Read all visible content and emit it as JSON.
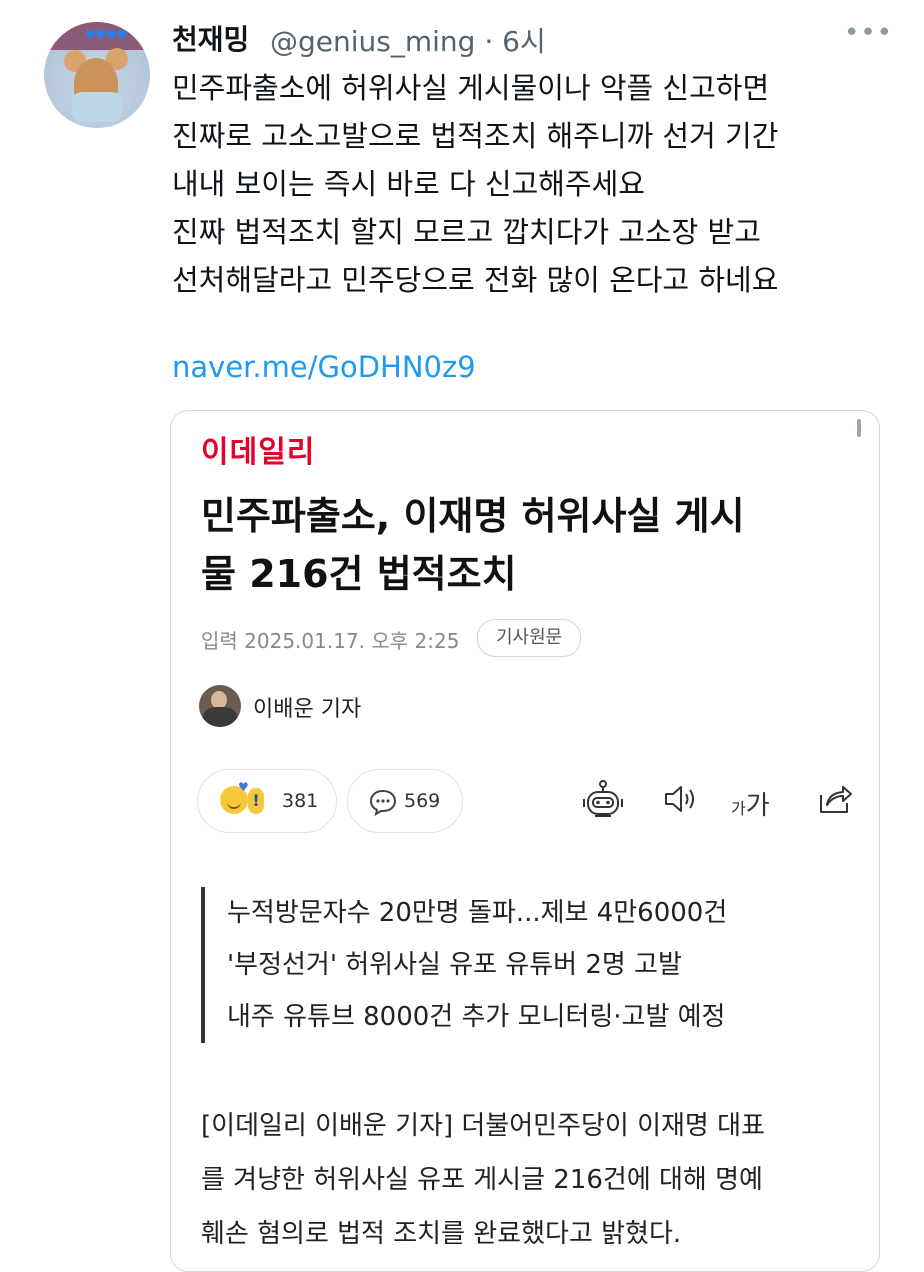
{
  "tweet": {
    "display_name": "천재밍",
    "handle_time": "@genius_ming · 6시",
    "more_icon": "more-horizontal-icon",
    "text_lines": [
      "민주파출소에 허위사실 게시물이나 악플 신고하면",
      "진짜로 고소고발으로 법적조치 해주니까 선거 기간",
      "내내 보이는 즉시 바로 다 신고해주세요",
      "진짜 법적조치 할지 모르고 깝치다가 고소장 받고",
      "선처해달라고 민주당으로 전화 많이 온다고 하네요"
    ],
    "link": "naver.me/GoDHN0z9"
  },
  "article": {
    "outlet": "이데일리",
    "headline_lines": [
      "민주파출소, 이재명 허위사실 게시",
      "물 216건 법적조치"
    ],
    "date": "입력 2025.01.17. 오후 2:25",
    "original_button": "기사원문",
    "reporter": "이배운 기자",
    "reactions_count": "381",
    "comments_count": "569",
    "font_small": "가",
    "font_big": "가",
    "summary_lines": [
      "누적방문자수 20만명 돌파...제보 4만6000건",
      "'부정선거' 허위사실 유포 유튜버 2명 고발",
      "내주 유튜브 8000건 추가 모니터링·고발 예정"
    ],
    "body_lines": [
      "[이데일리 이배운 기자] 더불어민주당이 이재명 대표",
      "를 겨냥한 허위사실 유포 게시글 216건에 대해 명예",
      "훼손 혐의로 법적 조치를 완료했다고 밝혔다."
    ]
  },
  "colors": {
    "link": "#1d9bf0",
    "outlet_red": "#e4002b",
    "muted": "#536471"
  }
}
